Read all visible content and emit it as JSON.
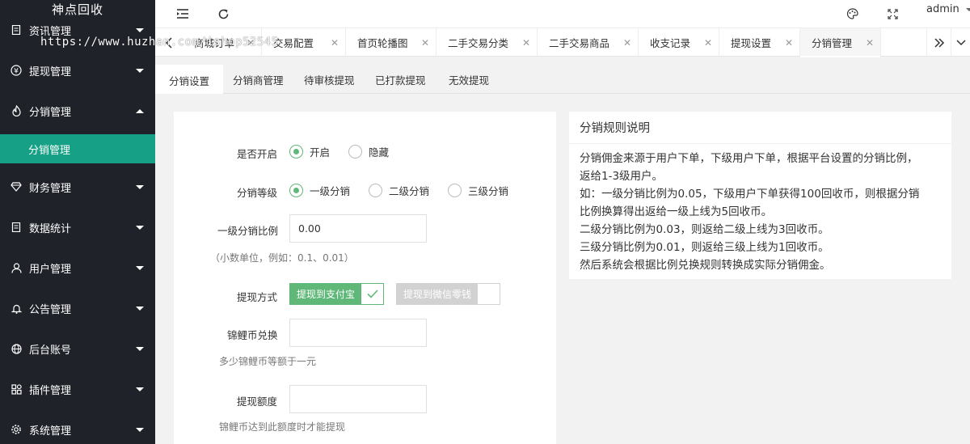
{
  "sidebar": {
    "brand": "神点回收",
    "watermark": "https://www.huzhan.com/ishop52545",
    "items": [
      {
        "label": "资讯管理",
        "icon": "doc-icon"
      },
      {
        "label": "提现管理",
        "icon": "yen-icon"
      },
      {
        "label": "分销管理",
        "icon": "fire-icon"
      },
      {
        "label": "财务管理",
        "icon": "diamond-icon"
      },
      {
        "label": "数据统计",
        "icon": "doc-icon"
      },
      {
        "label": "用户管理",
        "icon": "user-icon"
      },
      {
        "label": "公告管理",
        "icon": "bell-icon"
      },
      {
        "label": "后台账号",
        "icon": "globe-icon"
      },
      {
        "label": "插件管理",
        "icon": "plugin-icon"
      },
      {
        "label": "系统管理",
        "icon": "gear-icon"
      }
    ],
    "sub_item": "分销管理"
  },
  "header": {
    "user": "admin"
  },
  "tabs": [
    {
      "label": "商城订单"
    },
    {
      "label": "交易配置"
    },
    {
      "label": "首页轮播图"
    },
    {
      "label": "二手交易分类"
    },
    {
      "label": "二手交易商品"
    },
    {
      "label": "收支记录"
    },
    {
      "label": "提现设置"
    },
    {
      "label": "分销管理"
    }
  ],
  "subtabs": [
    "分销设置",
    "分销商管理",
    "待审核提现",
    "已打款提现",
    "无效提现"
  ],
  "form": {
    "enable_label": "是否开启",
    "enable_options": [
      "开启",
      "隐藏"
    ],
    "level_label": "分销等级",
    "level_options": [
      "一级分销",
      "二级分销",
      "三级分销"
    ],
    "ratio_label": "一级分销比例",
    "ratio_value": "0.00",
    "ratio_hint": "（小数单位，例如：0.1、0.01）",
    "withdraw_label": "提现方式",
    "withdraw_alipay": "提现到支付宝",
    "withdraw_wechat": "提现到微信零钱",
    "exchange_label": "锦鲤币兑换",
    "exchange_hint": "多少锦鲤币等额于一元",
    "min_label": "提现额度",
    "min_hint": "锦鲤币达到此额度时才能提现"
  },
  "rules": {
    "title": "分销规则说明",
    "lines": [
      "分销佣金来源于用户下单，下级用户下单，根据平台设置的分销比例，",
      "返给1-3级用户。",
      "如：一级分销比例为0.05，下级用户下单获得100回收币，则根据分销",
      "比例换算得出返给一级上线为5回收币。",
      "二级分销比例为0.03，则返给二级上线为3回收币。",
      "三级分销比例为0.01，则返给三级上线为1回收币。",
      "然后系统会根据比例兑换规则转换成实际分销佣金。"
    ]
  },
  "colors": {
    "sidebar_bg": "#20222a",
    "accent": "#16a085",
    "checkbox_green": "#5fb878"
  }
}
